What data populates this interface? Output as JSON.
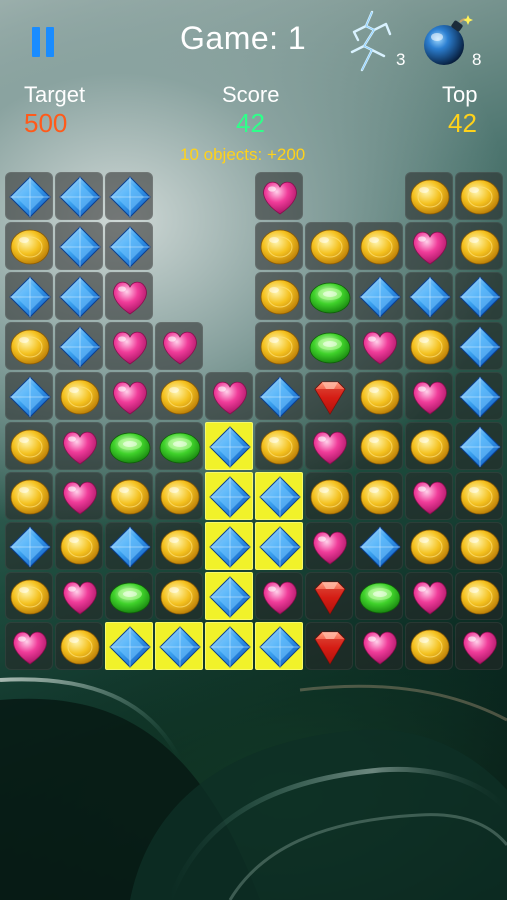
{
  "header": {
    "title": "Game: 1",
    "lightning_count": "3",
    "bomb_count": "8"
  },
  "stats": {
    "target_label": "Target",
    "target_value": "500",
    "score_label": "Score",
    "score_value": "42",
    "top_label": "Top",
    "top_value": "42"
  },
  "bonus_text": "10 objects: +200",
  "colors": {
    "target": "#ff5a1a",
    "score": "#2fff8a",
    "top": "#ffd21a",
    "selection": "#f1f22a",
    "pause": "#1a8cff"
  },
  "board": {
    "legend": {
      "B": "blue-diamond",
      "Y": "yellow-coin",
      "H": "pink-heart",
      "G": "green-gem",
      "R": "red-diamond",
      ".": "empty"
    },
    "rows": [
      "BBB..H..YY",
      "YBB..YYYHY",
      "BBH..YGBBB",
      "YBHH.YGHYB",
      "BYHYHBRYHB",
      "YHGGBYHYYB",
      "YHYYBBYYHY",
      "BYBYBBHBYY",
      "YHGYBHRGHY",
      "HYBBBBRHYH"
    ],
    "selected": [
      [
        5,
        4
      ],
      [
        6,
        4
      ],
      [
        6,
        5
      ],
      [
        7,
        4
      ],
      [
        7,
        5
      ],
      [
        8,
        4
      ],
      [
        9,
        2
      ],
      [
        9,
        3
      ],
      [
        9,
        4
      ],
      [
        9,
        5
      ]
    ]
  }
}
